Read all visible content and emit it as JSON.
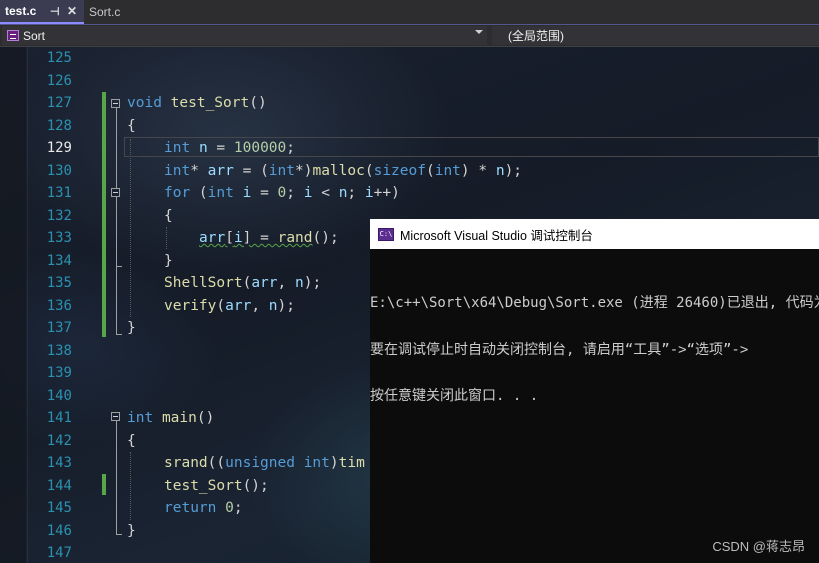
{
  "tabs": [
    {
      "label": "test.c",
      "pin_icon": "pin-icon",
      "close_icon": "close-icon"
    },
    {
      "label": "Sort.c"
    }
  ],
  "navbar": {
    "scope": "Sort",
    "global_scope": "(全局范围)"
  },
  "editor": {
    "current_line": "129",
    "line_numbers": [
      "125",
      "126",
      "127",
      "128",
      "129",
      "130",
      "131",
      "132",
      "133",
      "134",
      "135",
      "136",
      "137",
      "138",
      "139",
      "140",
      "141",
      "142",
      "143",
      "144",
      "145",
      "146",
      "147"
    ],
    "code": {
      "l127": {
        "kw": "void",
        "fn": "test_Sort",
        "rest": "()"
      },
      "l128": "{",
      "l129": {
        "kw": "int",
        "var": "n",
        "op": " = ",
        "num": "100000",
        "end": ";"
      },
      "l130": {
        "kw1": "int",
        "star": "* ",
        "var": "arr",
        "op": " = (",
        "kw2": "int",
        "cast": "*)",
        "fn": "malloc",
        "p1": "(",
        "kw3": "sizeof",
        "p2": "(",
        "kw4": "int",
        "p3": ") * ",
        "var2": "n",
        "end": ");"
      },
      "l131": {
        "kw": "for",
        "p1": " (",
        "kw2": "int",
        "var": "i",
        "op": " = ",
        "num": "0",
        "p2": "; ",
        "var2": "i",
        "op2": " < ",
        "var3": "n",
        "p3": "; ",
        "var4": "i",
        "end": "++)"
      },
      "l132": "{",
      "l133": {
        "var": "arr",
        "p1": "[",
        "var2": "i",
        "p2": "] = ",
        "fn": "rand",
        "end": "();"
      },
      "l134": "}",
      "l135": {
        "fn": "ShellSort",
        "p1": "(",
        "var": "arr",
        "p2": ", ",
        "var2": "n",
        "end": ");"
      },
      "l136": {
        "fn": "verify",
        "p1": "(",
        "var": "arr",
        "p2": ", ",
        "var2": "n",
        "end": ");"
      },
      "l137": "}",
      "l141": {
        "kw": "int",
        "fn": "main",
        "rest": "()"
      },
      "l142": "{",
      "l143": {
        "fn": "srand",
        "p1": "((",
        "kw": "unsigned",
        "sp": " ",
        "kw2": "int",
        "p2": ")",
        "fn2": "tim"
      },
      "l144": {
        "fn": "test_Sort",
        "end": "();"
      },
      "l145": {
        "kw": "return",
        "sp": " ",
        "num": "0",
        "end": ";"
      },
      "l146": "}"
    }
  },
  "console": {
    "icon": "console-app-icon",
    "title": "Microsoft Visual Studio 调试控制台",
    "lines": [
      "E:\\c++\\Sort\\x64\\Debug\\Sort.exe (进程 26460)已退出, 代码为",
      "要在调试停止时自动关闭控制台, 请启用“工具”->“选项”->",
      "按任意键关闭此窗口. . ."
    ]
  },
  "watermark": "CSDN @蒋志昂",
  "colors": {
    "keyword": "#569cd6",
    "function": "#dcdcaa",
    "variable": "#9cdcfe",
    "number": "#b5cea8",
    "line_number": "#2b91af",
    "change_bar": "#57a64a"
  }
}
